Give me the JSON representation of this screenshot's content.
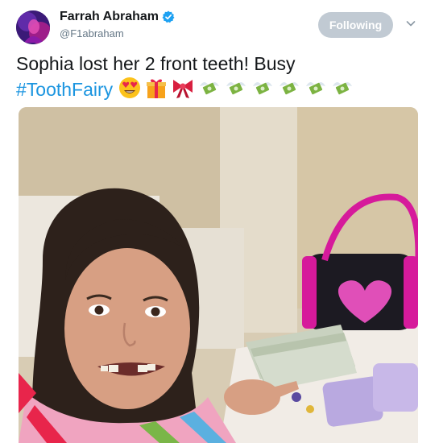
{
  "user": {
    "display_name": "Farrah Abraham",
    "handle": "@F1abraham",
    "verified": true,
    "avatar_icon": "profile-avatar"
  },
  "follow_button": {
    "label": "Following",
    "color": "#c1cad3"
  },
  "menu": {
    "icon": "chevron-down-icon"
  },
  "tweet": {
    "text": "Sophia lost her 2 front teeth! Busy",
    "hashtag": "#ToothFairy",
    "emojis": [
      "heart-eyes-emoji",
      "gift-emoji",
      "ribbon-emoji",
      "money-with-wings-emoji",
      "money-with-wings-emoji",
      "money-with-wings-emoji",
      "money-with-wings-emoji",
      "money-with-wings-emoji",
      "money-with-wings-emoji"
    ]
  },
  "photo": {
    "subject": "tweet-photo"
  },
  "colors": {
    "text": "#14171a",
    "secondary": "#657786",
    "link": "#1b95e0",
    "verified": "#1da1f2"
  }
}
